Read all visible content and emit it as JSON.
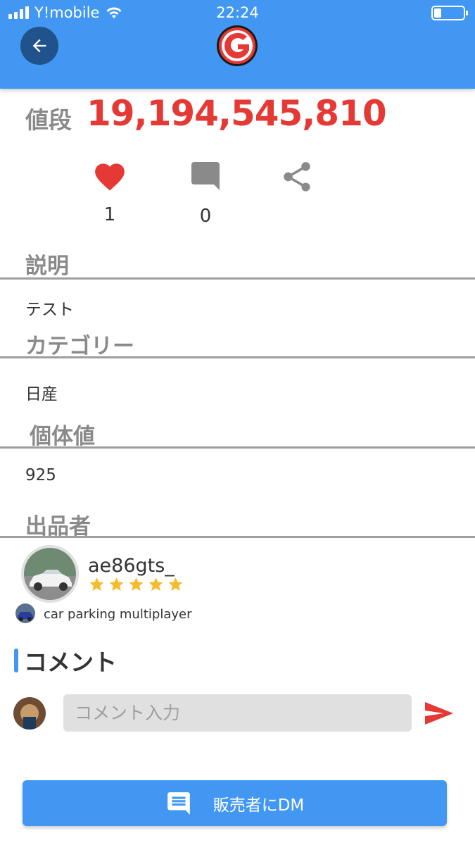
{
  "status_bar": {
    "carrier": "Y!mobile",
    "time": "22:24",
    "battery_level": 0.25,
    "icons": [
      "signal-icon",
      "wifi-icon",
      "battery-icon"
    ]
  },
  "header": {
    "back_icon": "arrow-left-icon",
    "logo_letter": "G",
    "background_color": "#4197f1"
  },
  "price": {
    "label": "値段",
    "value": "19,194,545,810",
    "color": "#e53935"
  },
  "actions": {
    "likes": "1",
    "comments": "0",
    "icons": [
      "heart-icon",
      "comment-icon",
      "share-icon"
    ]
  },
  "sections": {
    "description": {
      "title": "説明",
      "value": "テスト"
    },
    "category": {
      "title": "カテゴリー",
      "value": "日産"
    },
    "individual_value": {
      "title": "個体値",
      "value": "925"
    },
    "seller": {
      "title": "出品者"
    }
  },
  "seller": {
    "name": "ae86gts_",
    "rating": 5,
    "game": "car parking multiplayer"
  },
  "comments": {
    "heading": "コメント",
    "input_placeholder": "コメント入力",
    "send_icon": "send-icon"
  },
  "dm_button": {
    "label": "販売者にDM",
    "icon": "chat-icon"
  }
}
